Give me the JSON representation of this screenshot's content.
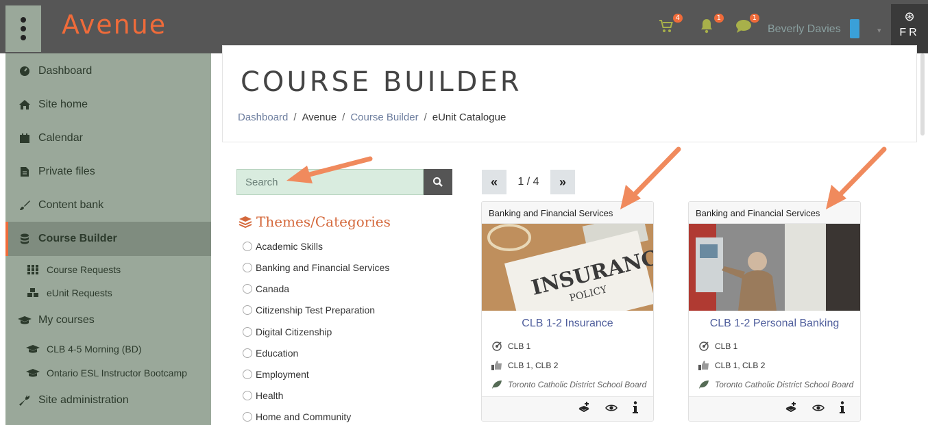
{
  "header": {
    "logo": "Avenue",
    "cart_count": "4",
    "notif_count": "1",
    "msg_count": "1",
    "username": "Beverly Davies",
    "lang": "FR"
  },
  "sidebar": {
    "items": [
      {
        "label": "Dashboard",
        "icon": "dashboard-icon"
      },
      {
        "label": "Site home",
        "icon": "home-icon"
      },
      {
        "label": "Calendar",
        "icon": "calendar-icon"
      },
      {
        "label": "Private files",
        "icon": "file-icon"
      },
      {
        "label": "Content bank",
        "icon": "brush-icon"
      },
      {
        "label": "Course Builder",
        "icon": "database-icon",
        "active": true
      },
      {
        "label": "Course Requests",
        "icon": "grid-icon"
      },
      {
        "label": "eUnit Requests",
        "icon": "cubes-icon"
      },
      {
        "label": "My courses",
        "icon": "graduation-cap-icon"
      },
      {
        "label": "CLB 4-5 Morning (BD)",
        "icon": "graduation-cap-icon"
      },
      {
        "label": "Ontario ESL Instructor Bootcamp",
        "icon": "graduation-cap-icon"
      },
      {
        "label": "Site administration",
        "icon": "wrench-icon"
      }
    ]
  },
  "page": {
    "title": "COURSE BUILDER",
    "breadcrumb": [
      "Dashboard",
      "Avenue",
      "Course Builder",
      "eUnit Catalogue"
    ]
  },
  "search": {
    "placeholder": "Search"
  },
  "categories": {
    "title": "Themes/Categories",
    "items": [
      "Academic Skills",
      "Banking and Financial Services",
      "Canada",
      "Citizenship Test Preparation",
      "Digital Citizenship",
      "Education",
      "Employment",
      "Health",
      "Home and Community"
    ]
  },
  "pager": {
    "label": "1 / 4",
    "prev": "«",
    "next": "»"
  },
  "cards": [
    {
      "category": "Banking and Financial Services",
      "title": "CLB 1-2 Insurance",
      "level": "CLB 1",
      "levels": "CLB 1, CLB 2",
      "org": "Toronto Catholic District School Board",
      "image_text_1": "INSURANCE",
      "image_text_2": "POLICY"
    },
    {
      "category": "Banking and Financial Services",
      "title": "CLB 1-2 Personal Banking",
      "level": "CLB 1",
      "levels": "CLB 1, CLB 2",
      "org": "Toronto Catholic District School Board"
    }
  ],
  "colors": {
    "accent": "#ef6b3a",
    "sidebar": "#9aa89a",
    "header": "#565656",
    "link": "#4f5e9c"
  }
}
